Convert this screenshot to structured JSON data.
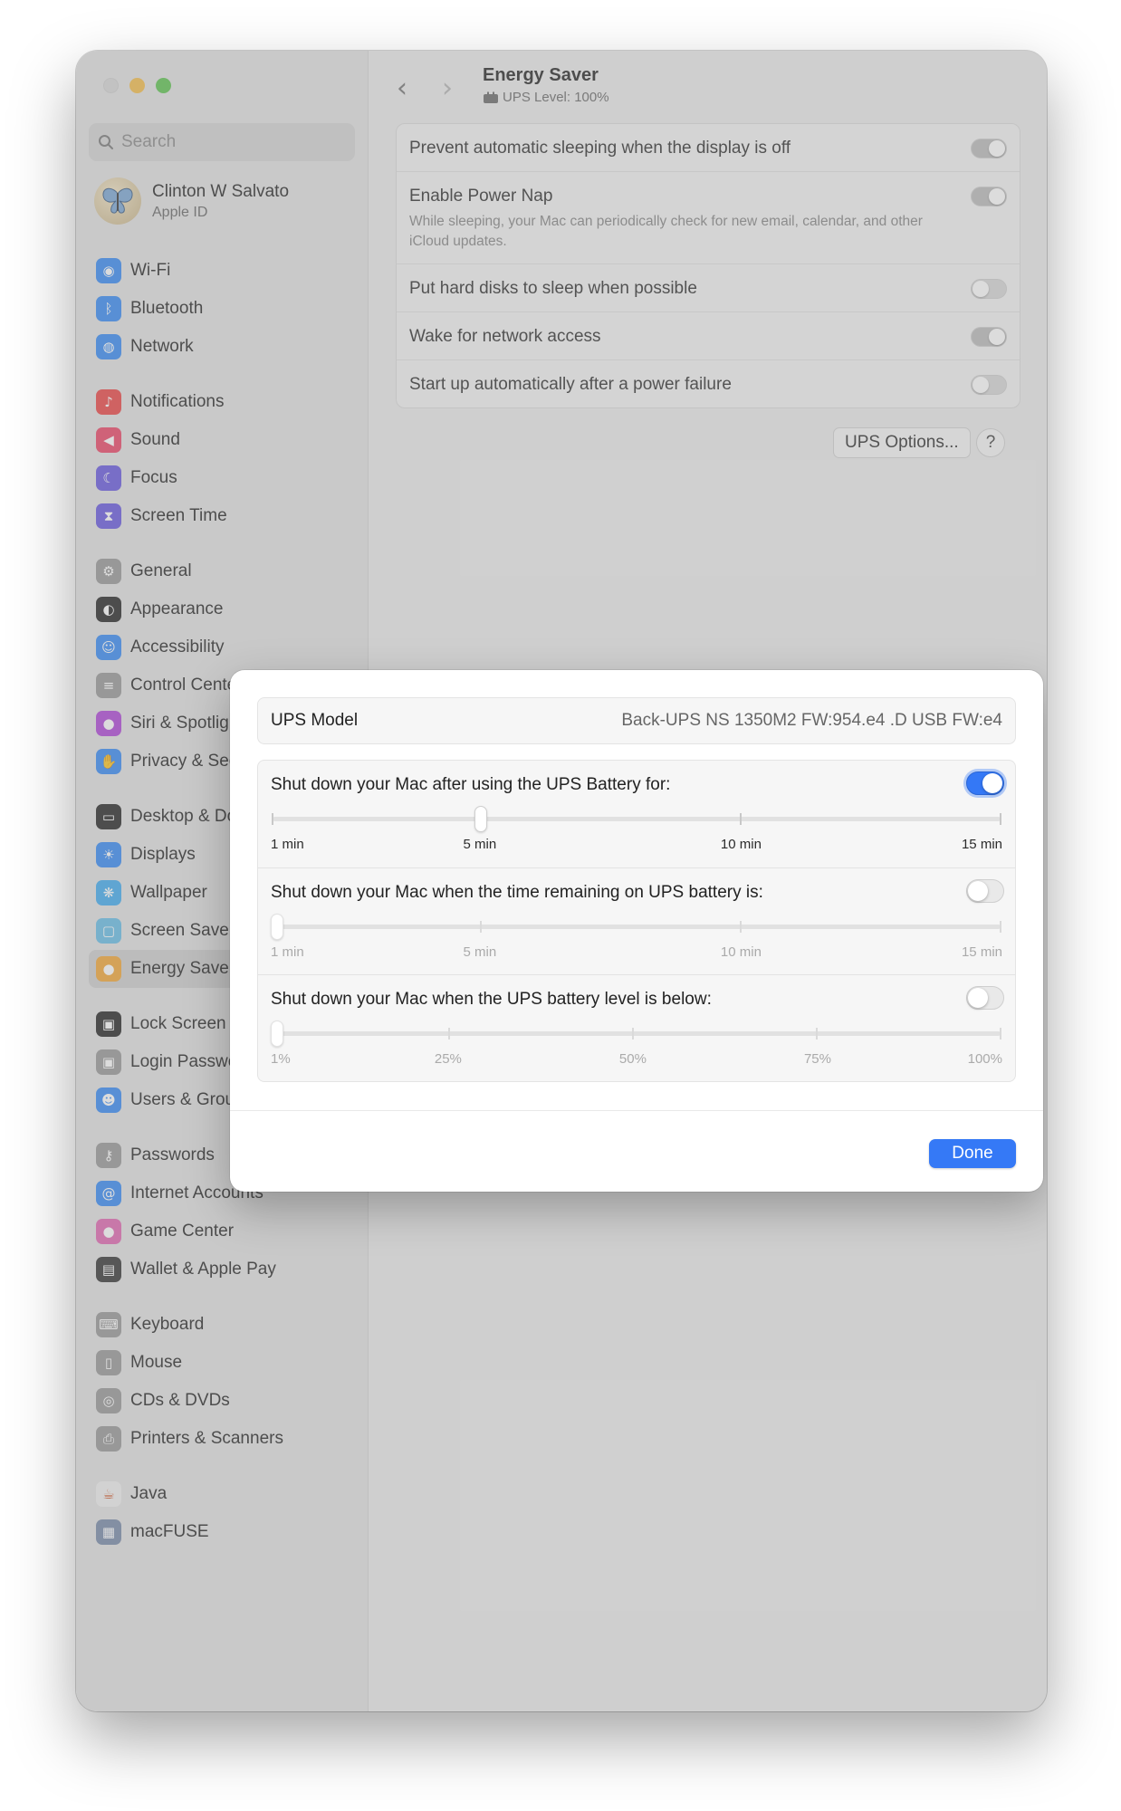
{
  "sidebar": {
    "search_placeholder": "Search",
    "profile": {
      "name": "Clinton W Salvato",
      "subtitle": "Apple ID"
    },
    "items": [
      {
        "label": "Wi-Fi",
        "icon": "wifi-icon",
        "color": "#3b8df5"
      },
      {
        "label": "Bluetooth",
        "icon": "bluetooth-icon",
        "color": "#3b8df5"
      },
      {
        "label": "Network",
        "icon": "globe-icon",
        "color": "#3b8df5"
      },
      {
        "label": "Notifications",
        "icon": "bell-icon",
        "color": "#ec4a4a"
      },
      {
        "label": "Sound",
        "icon": "speaker-icon",
        "color": "#ec4a6a"
      },
      {
        "label": "Focus",
        "icon": "moon-icon",
        "color": "#6a5be0"
      },
      {
        "label": "Screen Time",
        "icon": "hourglass-icon",
        "color": "#6a5be0"
      },
      {
        "label": "General",
        "icon": "gear-icon",
        "color": "#9a9a9a"
      },
      {
        "label": "Appearance",
        "icon": "appearance-icon",
        "color": "#2b2b2b"
      },
      {
        "label": "Accessibility",
        "icon": "accessibility-icon",
        "color": "#3b8df5"
      },
      {
        "label": "Control Center",
        "icon": "control-center-icon",
        "color": "#9a9a9a"
      },
      {
        "label": "Siri & Spotlight",
        "icon": "siri-icon",
        "color": "#b04ad8"
      },
      {
        "label": "Privacy & Security",
        "icon": "hand-icon",
        "color": "#3b8df5"
      },
      {
        "label": "Desktop & Dock",
        "icon": "dock-icon",
        "color": "#2b2b2b"
      },
      {
        "label": "Displays",
        "icon": "sun-icon",
        "color": "#3b8df5"
      },
      {
        "label": "Wallpaper",
        "icon": "wallpaper-icon",
        "color": "#45aef0"
      },
      {
        "label": "Screen Saver",
        "icon": "screensaver-icon",
        "color": "#6bbfe8"
      },
      {
        "label": "Energy Saver",
        "icon": "bulb-icon",
        "color": "#f3a93b"
      },
      {
        "label": "Lock Screen",
        "icon": "lock-icon",
        "color": "#2b2b2b"
      },
      {
        "label": "Login Password",
        "icon": "lock-icon",
        "color": "#9a9a9a"
      },
      {
        "label": "Users & Groups",
        "icon": "users-icon",
        "color": "#3b8df5"
      },
      {
        "label": "Passwords",
        "icon": "key-icon",
        "color": "#9a9a9a"
      },
      {
        "label": "Internet Accounts",
        "icon": "at-icon",
        "color": "#3b8df5"
      },
      {
        "label": "Game Center",
        "icon": "game-center-icon",
        "color": "#e26bb3"
      },
      {
        "label": "Wallet & Apple Pay",
        "icon": "wallet-icon",
        "color": "#3a3a3a"
      },
      {
        "label": "Keyboard",
        "icon": "keyboard-icon",
        "color": "#9a9a9a"
      },
      {
        "label": "Mouse",
        "icon": "mouse-icon",
        "color": "#9a9a9a"
      },
      {
        "label": "CDs & DVDs",
        "icon": "disc-icon",
        "color": "#9a9a9a"
      },
      {
        "label": "Printers & Scanners",
        "icon": "printer-icon",
        "color": "#9a9a9a"
      },
      {
        "label": "Java",
        "icon": "java-icon",
        "color": "#f0f0f0"
      },
      {
        "label": "macFUSE",
        "icon": "macfuse-icon",
        "color": "#7b8cab"
      }
    ]
  },
  "header": {
    "title": "Energy Saver",
    "subtitle": "UPS Level: 100%"
  },
  "settings": [
    {
      "label": "Prevent automatic sleeping when the display is off",
      "desc": "",
      "on": true
    },
    {
      "label": "Enable Power Nap",
      "desc": "While sleeping, your Mac can periodically check for new email, calendar, and other iCloud updates.",
      "on": true
    },
    {
      "label": "Put hard disks to sleep when possible",
      "desc": "",
      "on": false
    },
    {
      "label": "Wake for network access",
      "desc": "",
      "on": true
    },
    {
      "label": "Start up automatically after a power failure",
      "desc": "",
      "on": false
    }
  ],
  "buttons": {
    "ups_options": "UPS Options...",
    "help": "?"
  },
  "modal": {
    "model_label": "UPS Model",
    "model_value": "Back-UPS NS 1350M2 FW:954.e4 .D USB FW:e4",
    "sliders": [
      {
        "title": "Shut down your Mac after using the UPS Battery for:",
        "enabled": true,
        "labels": [
          "1 min",
          "5 min",
          "10 min",
          "15 min"
        ],
        "min": 1,
        "max": 15,
        "value": 5,
        "ticks": [
          1,
          5,
          10,
          15
        ]
      },
      {
        "title": "Shut down your Mac when the time remaining on UPS battery is:",
        "enabled": false,
        "labels": [
          "1 min",
          "5 min",
          "10 min",
          "15 min"
        ],
        "min": 1,
        "max": 15,
        "value": 1,
        "ticks": [
          1,
          5,
          10,
          15
        ]
      },
      {
        "title": "Shut down your Mac when the UPS battery level is below:",
        "enabled": false,
        "labels": [
          "1%",
          "25%",
          "50%",
          "75%",
          "100%"
        ],
        "min": 1,
        "max": 100,
        "value": 1,
        "ticks": [
          1,
          25,
          50,
          75,
          100
        ]
      }
    ],
    "done_label": "Done"
  }
}
